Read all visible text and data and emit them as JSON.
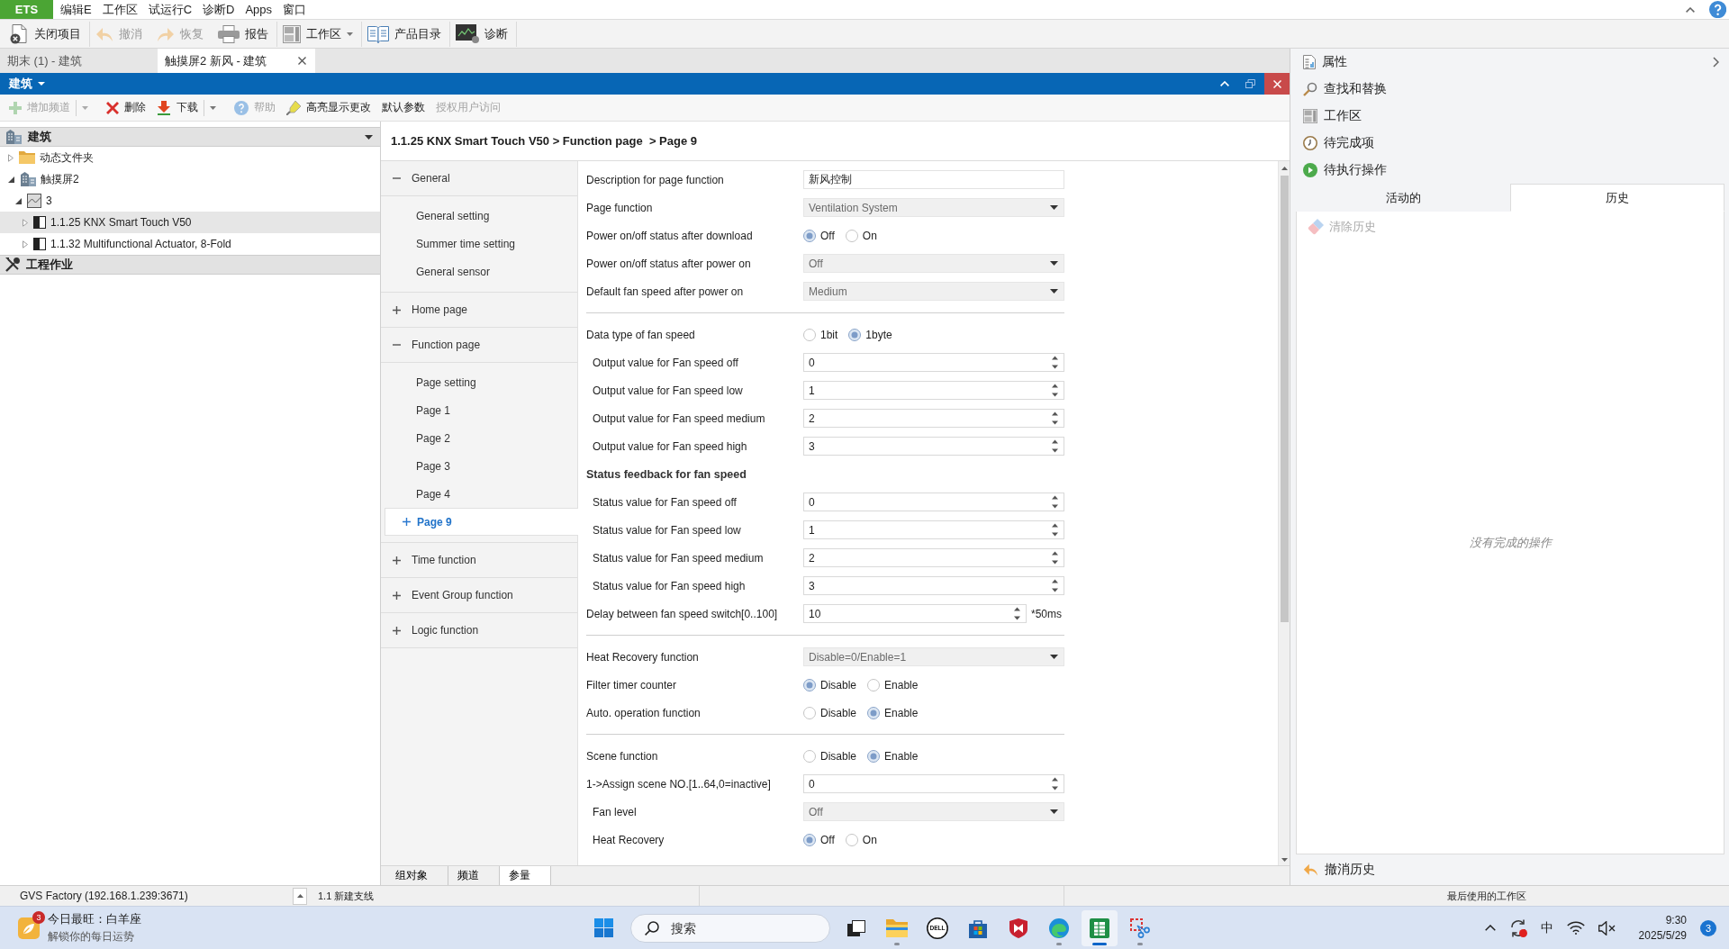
{
  "menu_bar": {
    "app": "ETS",
    "items": [
      "编辑E",
      "工作区",
      "试运行C",
      "诊断D",
      "Apps",
      "窗口"
    ]
  },
  "toolbar": [
    {
      "kind": "close-project",
      "label": "关闭项目",
      "disabled": false,
      "menu": false
    },
    {
      "kind": "undo",
      "label": "撤消",
      "disabled": true,
      "menu": false
    },
    {
      "kind": "redo",
      "label": "恢复",
      "disabled": true,
      "menu": false
    },
    {
      "kind": "print",
      "label": "报告",
      "disabled": false,
      "menu": false
    },
    {
      "kind": "layout",
      "label": "工作区",
      "disabled": false,
      "menu": true
    },
    {
      "kind": "catalog",
      "label": "产品目录",
      "disabled": false,
      "menu": false
    },
    {
      "kind": "monitor",
      "label": "诊断",
      "disabled": false,
      "menu": false
    }
  ],
  "document_tabs": [
    {
      "label": "期末 (1) - 建筑",
      "selected": false
    },
    {
      "label": "触摸屏2 新风 - 建筑",
      "selected": true
    }
  ],
  "panel": {
    "title": "建筑",
    "toolbar": [
      {
        "kind": "add",
        "label": "增加频道",
        "disabled": true,
        "menu": true
      },
      {
        "kind": "delete",
        "label": "删除",
        "disabled": false,
        "menu": false
      },
      {
        "kind": "download",
        "label": "下载",
        "disabled": false,
        "menu": true
      },
      {
        "kind": "help",
        "label": "帮助",
        "disabled": true,
        "menu": false
      },
      {
        "kind": "highlight",
        "label": "高亮显示更改",
        "disabled": false,
        "menu": false
      },
      {
        "kind": "text",
        "label": "默认参数",
        "disabled": false,
        "menu": false
      },
      {
        "kind": "text",
        "label": "授权用户访问",
        "disabled": true,
        "menu": false
      }
    ]
  },
  "tree_sections": [
    {
      "title": "建筑",
      "kind": "building",
      "menu": true,
      "items": [
        {
          "label": "动态文件夹",
          "kind": "folder",
          "expanded": false,
          "selected": false
        },
        {
          "label": "触摸屏2",
          "kind": "building",
          "expanded": true,
          "selected": false,
          "children": [
            {
              "label": "3",
              "kind": "floor",
              "expanded": true,
              "selected": false,
              "children": [
                {
                  "label": "1.1.25 KNX Smart Touch V50",
                  "kind": "device",
                  "expanded": false,
                  "selected": true
                },
                {
                  "label": "1.1.32 Multifunctional Actuator, 8-Fold",
                  "kind": "device",
                  "expanded": false,
                  "selected": false
                }
              ]
            }
          ]
        }
      ]
    },
    {
      "title": "工程作业",
      "kind": "tools",
      "menu": false
    }
  ],
  "parameters": {
    "breadcrumb": "1.1.25 KNX Smart Touch V50 > Function page  > Page 9",
    "nav": [
      {
        "label": "General",
        "expanded": true,
        "children": [
          {
            "label": "General setting",
            "selected": false
          },
          {
            "label": "Summer time setting",
            "selected": false
          },
          {
            "label": "General sensor",
            "selected": false
          }
        ]
      },
      {
        "label": "Home page",
        "expanded": false
      },
      {
        "label": "Function page",
        "expanded": true,
        "children": [
          {
            "label": "Page setting",
            "selected": false
          },
          {
            "label": "Page 1",
            "selected": false
          },
          {
            "label": "Page 2",
            "selected": false
          },
          {
            "label": "Page 3",
            "selected": false
          },
          {
            "label": "Page 4",
            "selected": false
          },
          {
            "label": "Page 9",
            "selected": true,
            "expanded": false
          }
        ]
      },
      {
        "label": "Time function",
        "expanded": false
      },
      {
        "label": "Event Group function",
        "expanded": false
      },
      {
        "label": "Logic function",
        "expanded": false
      }
    ],
    "rows": [
      {
        "kind": "text",
        "label": "Description for page function",
        "value": "新风控制"
      },
      {
        "kind": "dropdown",
        "label": "Page function",
        "value": "Ventilation System"
      },
      {
        "kind": "radio",
        "label": "Power on/off status after download",
        "options": [
          {
            "label": "Off",
            "selected": true
          },
          {
            "label": "On",
            "selected": false
          }
        ]
      },
      {
        "kind": "dropdown",
        "label": "Power on/off status after power on",
        "value": "Off"
      },
      {
        "kind": "dropdown",
        "label": "Default fan speed after power on",
        "value": "Medium"
      },
      {
        "kind": "separator"
      },
      {
        "kind": "radio",
        "label": "Data type of fan speed",
        "options": [
          {
            "label": "1bit",
            "selected": false
          },
          {
            "label": "1byte",
            "selected": true
          }
        ],
        "children": [
          {
            "kind": "spin",
            "label": "Output value for Fan speed off",
            "value": "0"
          },
          {
            "kind": "spin",
            "label": "Output value for Fan speed low",
            "value": "1"
          },
          {
            "kind": "spin",
            "label": "Output value for Fan speed medium",
            "value": "2"
          },
          {
            "kind": "spin",
            "label": "Output value for Fan speed high",
            "value": "3"
          }
        ]
      },
      {
        "kind": "heading",
        "label": "Status feedback for fan speed",
        "children": [
          {
            "kind": "spin",
            "label": "Status value for Fan speed off",
            "value": "0"
          },
          {
            "kind": "spin",
            "label": "Status value for Fan speed low",
            "value": "1"
          },
          {
            "kind": "spin",
            "label": "Status value for Fan speed medium",
            "value": "2"
          },
          {
            "kind": "spin",
            "label": "Status value for Fan speed high",
            "value": "3"
          }
        ]
      },
      {
        "kind": "spin",
        "label": "Delay between fan speed switch[0..100]",
        "value": "10",
        "unit": "*50ms"
      },
      {
        "kind": "separator"
      },
      {
        "kind": "dropdown",
        "label": "Heat Recovery function",
        "value": "Disable=0/Enable=1"
      },
      {
        "kind": "radio",
        "label": "Filter timer counter",
        "options": [
          {
            "label": "Disable",
            "selected": true
          },
          {
            "label": "Enable",
            "selected": false
          }
        ]
      },
      {
        "kind": "radio",
        "label": "Auto. operation function",
        "options": [
          {
            "label": "Disable",
            "selected": false
          },
          {
            "label": "Enable",
            "selected": true
          }
        ]
      },
      {
        "kind": "separator"
      },
      {
        "kind": "radio",
        "label": "Scene function",
        "options": [
          {
            "label": "Disable",
            "selected": false
          },
          {
            "label": "Enable",
            "selected": true
          }
        ]
      },
      {
        "kind": "spin",
        "label": "1->Assign scene NO.[1..64,0=inactive]",
        "value": "0",
        "children": [
          {
            "kind": "dropdown",
            "label": "Fan level",
            "value": "Off"
          },
          {
            "kind": "radio",
            "label": "Heat Recovery",
            "options": [
              {
                "label": "Off",
                "selected": true
              },
              {
                "label": "On",
                "selected": false
              }
            ]
          }
        ]
      }
    ]
  },
  "bottom_tabs": [
    {
      "label": "组对象",
      "selected": false
    },
    {
      "label": "频道",
      "selected": false
    },
    {
      "label": "参量",
      "selected": true
    }
  ],
  "right_panel": {
    "items": [
      {
        "kind": "properties",
        "label": "属性"
      },
      {
        "kind": "search",
        "label": "查找和替换"
      },
      {
        "kind": "layout",
        "label": "工作区"
      },
      {
        "kind": "clock",
        "label": "待完成项"
      },
      {
        "kind": "play",
        "label": "待执行操作"
      }
    ],
    "tabs": [
      {
        "label": "活动的",
        "selected": false
      },
      {
        "label": "历史",
        "selected": true
      }
    ],
    "clear_button": {
      "label": "清除历史",
      "disabled": true
    },
    "empty_message": "没有完成的操作",
    "undo_history": "撤消历史"
  },
  "status_bar": {
    "connection": "GVS Factory (192.168.1.239:3671)",
    "line": "1.1 新建支线",
    "workspace": "最后使用的工作区"
  },
  "taskbar": {
    "widget": {
      "badge": "3",
      "title": "今日最旺：白羊座",
      "subtitle": "解锁你的每日运势"
    },
    "search": {
      "placeholder": "搜索"
    },
    "apps": [
      {
        "kind": "task-view",
        "running": false,
        "active": false
      },
      {
        "kind": "files",
        "running": true,
        "active": false
      },
      {
        "kind": "logo",
        "text": "DELL",
        "running": false,
        "active": false
      },
      {
        "kind": "store",
        "running": false,
        "active": false
      },
      {
        "kind": "shield",
        "running": false,
        "active": false
      },
      {
        "kind": "browser",
        "running": true,
        "active": false
      },
      {
        "kind": "sheet",
        "running": true,
        "active": true
      },
      {
        "kind": "snip",
        "running": true,
        "active": false
      }
    ],
    "tray": {
      "ime": "中",
      "time": "9:30",
      "date": "2025/5/29",
      "notifications": "3"
    }
  }
}
